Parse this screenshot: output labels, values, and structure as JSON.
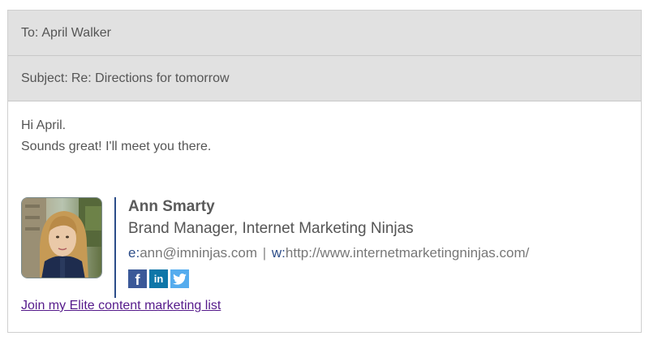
{
  "email": {
    "to": {
      "prefix": "To:",
      "value": "April Walker"
    },
    "subject": {
      "prefix": "Subject:",
      "value": "Re: Directions for tomorrow"
    },
    "body": {
      "line1": "Hi April.",
      "line2": "Sounds great! I'll meet you there."
    }
  },
  "signature": {
    "name": "Ann Smarty",
    "title": "Brand Manager, Internet Marketing Ninjas",
    "email_key": "e:",
    "email_value": "ann@imninjas.com",
    "separator": "|",
    "web_key": "w:",
    "web_value": "http://www.internetmarketingninjas.com/",
    "socials": [
      {
        "icon": "facebook-icon",
        "glyph": "f",
        "color": "#3b5998"
      },
      {
        "icon": "linkedin-icon",
        "glyph": "in",
        "color": "#0e76a8"
      },
      {
        "icon": "twitter-icon",
        "glyph": "",
        "color": "#55acee"
      }
    ],
    "link_text": "Join my Elite content marketing list"
  },
  "colors": {
    "header_bg": "#e1e1e1",
    "accent": "#2c4d89",
    "link": "#551a8b"
  }
}
